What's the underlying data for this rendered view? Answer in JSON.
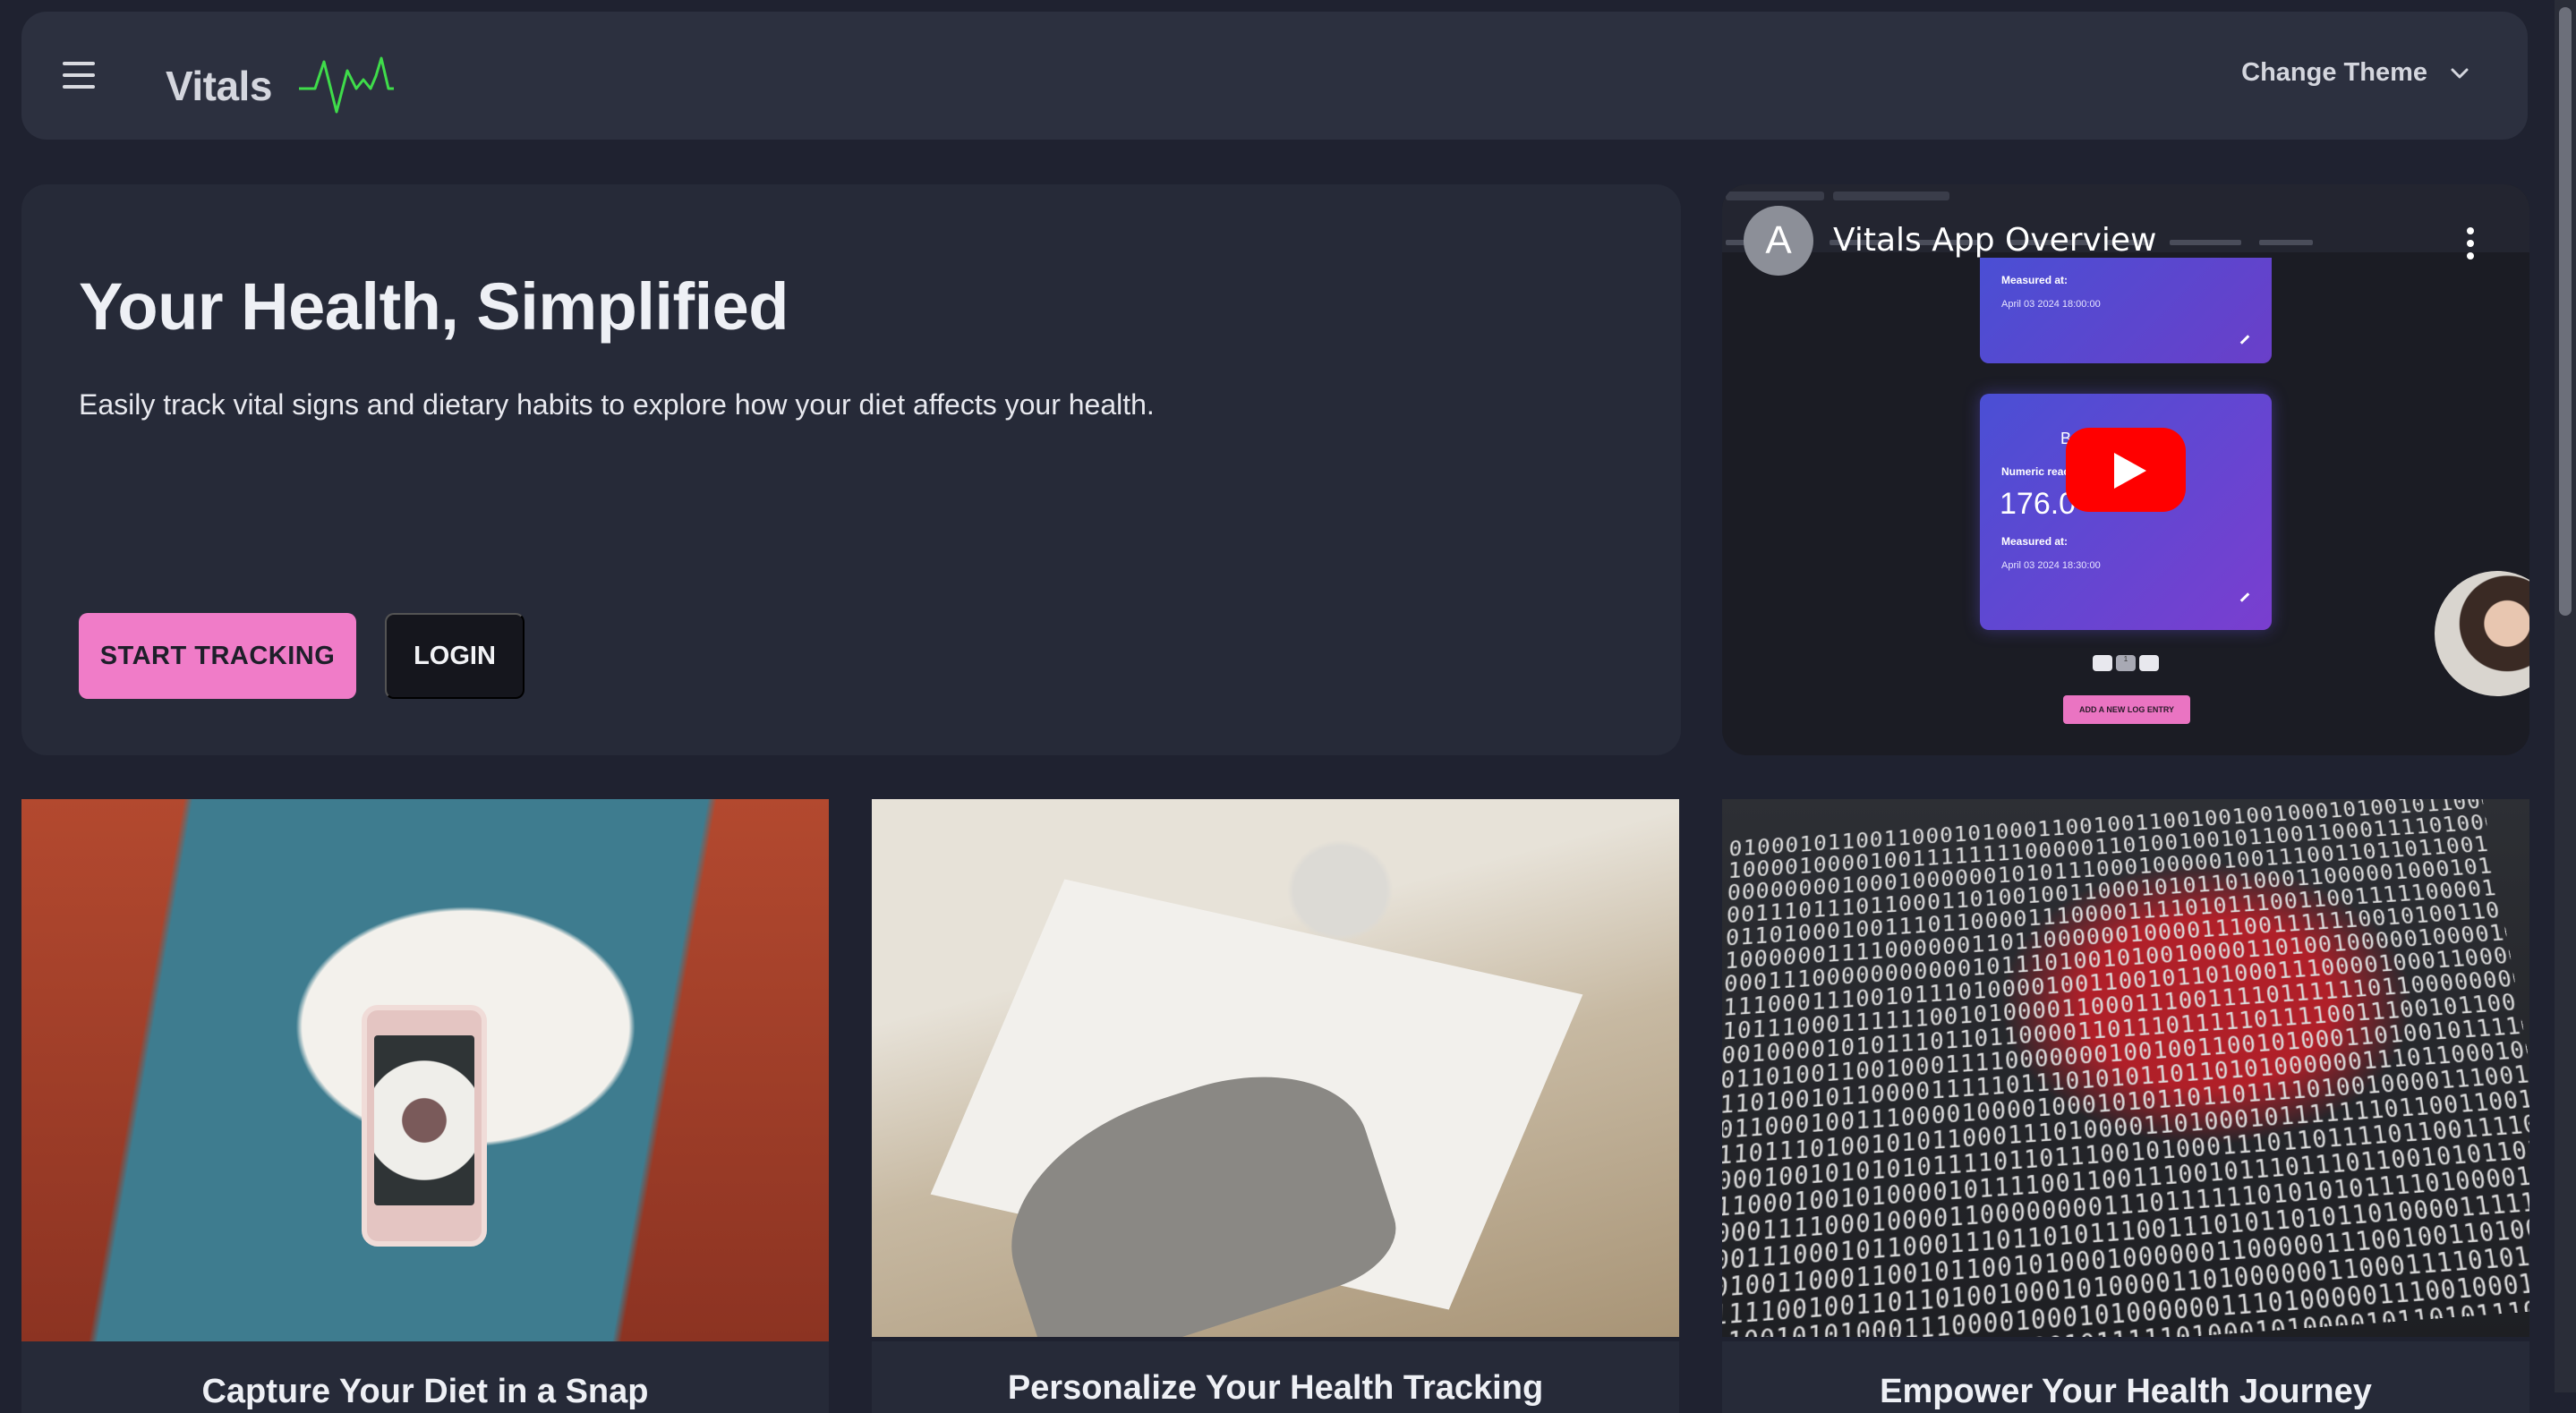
{
  "navbar": {
    "brand": "Vitals",
    "menu_icon": "hamburger-menu-icon",
    "brand_icon": "heartbeat-pulse-icon",
    "theme_label": "Change Theme",
    "theme_icon": "chevron-down-icon"
  },
  "hero": {
    "title": "Your Health, Simplified",
    "subtitle": "Easily track vital signs and dietary habits to explore how your diet affects your health.",
    "primary_button": "START TRACKING",
    "secondary_button": "LOGIN"
  },
  "video": {
    "channel_initial": "A",
    "title": "Vitals App Overview",
    "play_icon": "youtube-play-icon",
    "more_icon": "more-vertical-icon",
    "embedded": {
      "card1_measured_label": "Measured at:",
      "card1_timestamp": "April 03 2024 18:00:00",
      "card2_heading": "B                e",
      "card2_numeric_label": "Numeric reac",
      "card2_value": "176.0",
      "card2_measured_label": "Measured at:",
      "card2_timestamp": "April 03 2024 18:30:00",
      "pager_current": "1",
      "add_button": "ADD A NEW LOG ENTRY"
    }
  },
  "features": [
    {
      "title": "Capture Your Diet in a Snap",
      "image": "phone-photographing-meal"
    },
    {
      "title": "Personalize Your Health Tracking",
      "image": "hand-writing-notes"
    },
    {
      "title": "Empower Your Health Journey",
      "image": "binary-code-red-heart"
    }
  ],
  "colors": {
    "background": "#1f2230",
    "panel": "#262a38",
    "navbar": "#2c303f",
    "accent_pink": "#f07cc8",
    "pulse_green": "#3fdc4a",
    "youtube_red": "#ff0000"
  }
}
